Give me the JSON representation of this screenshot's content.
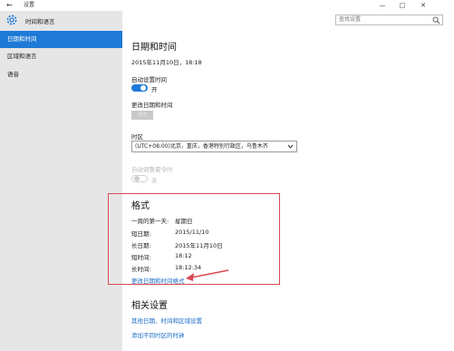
{
  "titlebar": {
    "back_glyph": "←",
    "title": "设置",
    "minimize": "—",
    "maximize": "□",
    "close": "✕"
  },
  "sidebar": {
    "header_label": "时间和语言",
    "items": [
      {
        "label": "日期和时间",
        "active": true
      },
      {
        "label": "区域和语言",
        "active": false
      },
      {
        "label": "语音",
        "active": false
      }
    ]
  },
  "search": {
    "placeholder": "查找设置"
  },
  "content": {
    "page_title": "日期和时间",
    "current_datetime": "2015年11月10日，18:18",
    "auto_time_label": "自动设置时间",
    "auto_time_state": "开",
    "change_datetime_label": "更改日期和时间",
    "change_button": "更改",
    "timezone_label": "时区",
    "timezone_value": "(UTC+08:00)北京，重庆，香港特别行政区，乌鲁木齐",
    "auto_dst_label": "自动调整夏令时",
    "auto_dst_state": "关",
    "format": {
      "title": "格式",
      "rows": [
        {
          "label": "一周的第一天:",
          "value": "星期日"
        },
        {
          "label": "短日期:",
          "value": "2015/11/10"
        },
        {
          "label": "长日期:",
          "value": "2015年11月10日"
        },
        {
          "label": "短时间:",
          "value": "18:12"
        },
        {
          "label": "长时间:",
          "value": "18:12:34"
        }
      ],
      "change_link": "更改日期和时间格式"
    },
    "related": {
      "title": "相关设置",
      "links": [
        "其他日期、时间和区域设置",
        "添加不同时区的时钟"
      ]
    }
  },
  "colors": {
    "accent": "#1e7ad6",
    "sidebar_bg": "#e6e6e6",
    "link": "#1a6cc7",
    "annotation": "#d94a52"
  }
}
